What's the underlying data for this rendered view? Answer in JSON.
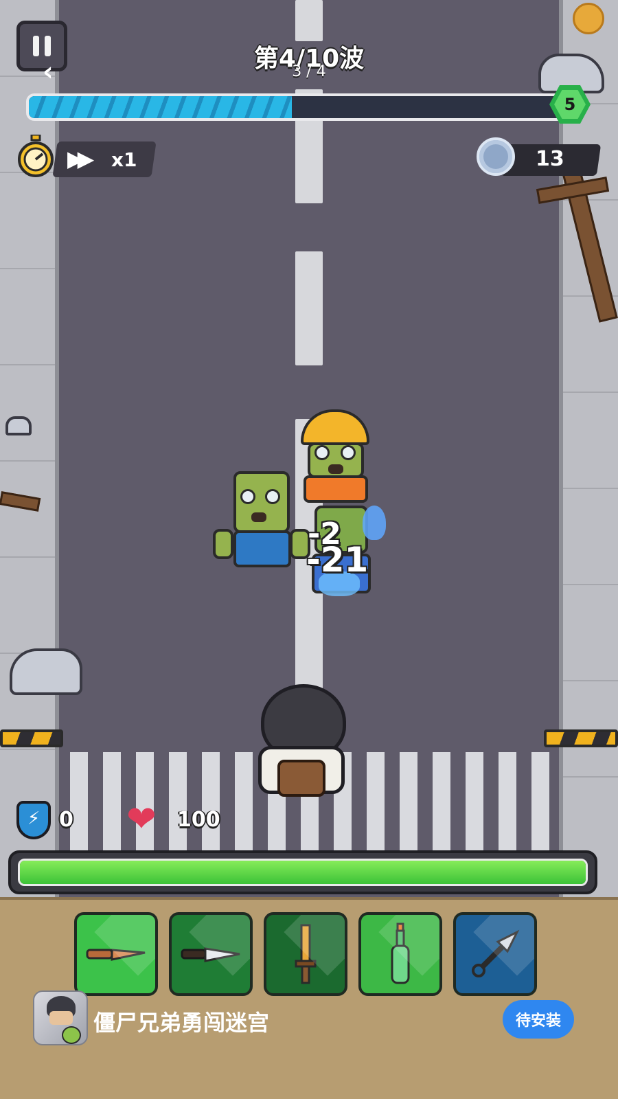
{
  "hud": {
    "wave_title": "第4/10波",
    "wave_sub": "3 / 4",
    "wave_progress": 0.49,
    "level": "5",
    "speed_label": "x1",
    "coins": "13"
  },
  "stats": {
    "shield": "0",
    "health": "100",
    "health_fill": 1.0
  },
  "damage_numbers": [
    "-2",
    "-21"
  ],
  "weapons": [
    {
      "name": "wooden-knife-icon"
    },
    {
      "name": "combat-knife-icon"
    },
    {
      "name": "dagger-icon"
    },
    {
      "name": "molotov-bottle-icon"
    },
    {
      "name": "kunai-icon"
    }
  ],
  "ad": {
    "app_name": "僵尸兄弟勇闯迷宫",
    "install_label": "待安装"
  },
  "colors": {
    "wave_bar": "#29b7e6",
    "hp_bar": "#5fd84a",
    "install_button": "#2f87f0",
    "panel_bg": "#b79d71"
  }
}
